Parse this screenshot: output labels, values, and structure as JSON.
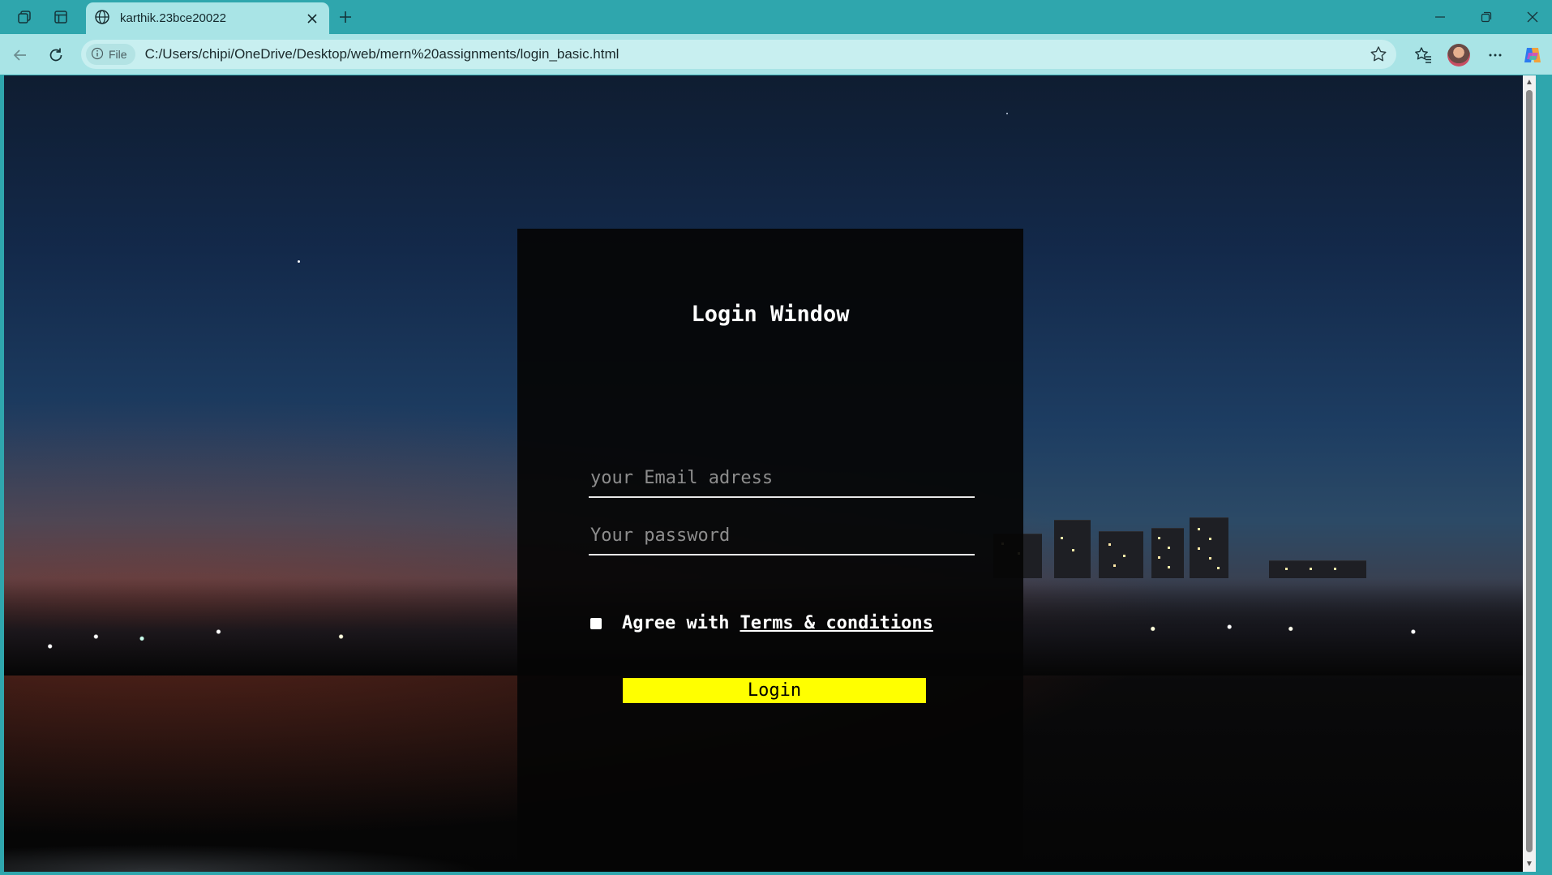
{
  "browser": {
    "tab_title": "karthik.23bce20022",
    "file_chip": "File",
    "url": "C:/Users/chipi/OneDrive/Desktop/web/mern%20assignments/login_basic.html",
    "icons": [
      "workspaces-icon",
      "vertical-tabs-icon",
      "globe-icon",
      "close-icon",
      "plus-icon",
      "minimize-icon",
      "restore-icon",
      "close-window-icon",
      "back-icon",
      "refresh-icon",
      "info-icon",
      "star-icon",
      "favorites-icon",
      "avatar",
      "more-icon",
      "copilot-icon"
    ]
  },
  "login": {
    "title": "Login Window",
    "email_placeholder": "your Email adress",
    "password_placeholder": "Your password",
    "agree_text": "Agree with",
    "terms_link": "Terms & conditions",
    "button_label": "Login"
  },
  "colors": {
    "chrome_teal": "#2fa6ad",
    "toolbar": "#a9e4e6",
    "button_yellow": "#ffff00",
    "panel": "#050505"
  }
}
